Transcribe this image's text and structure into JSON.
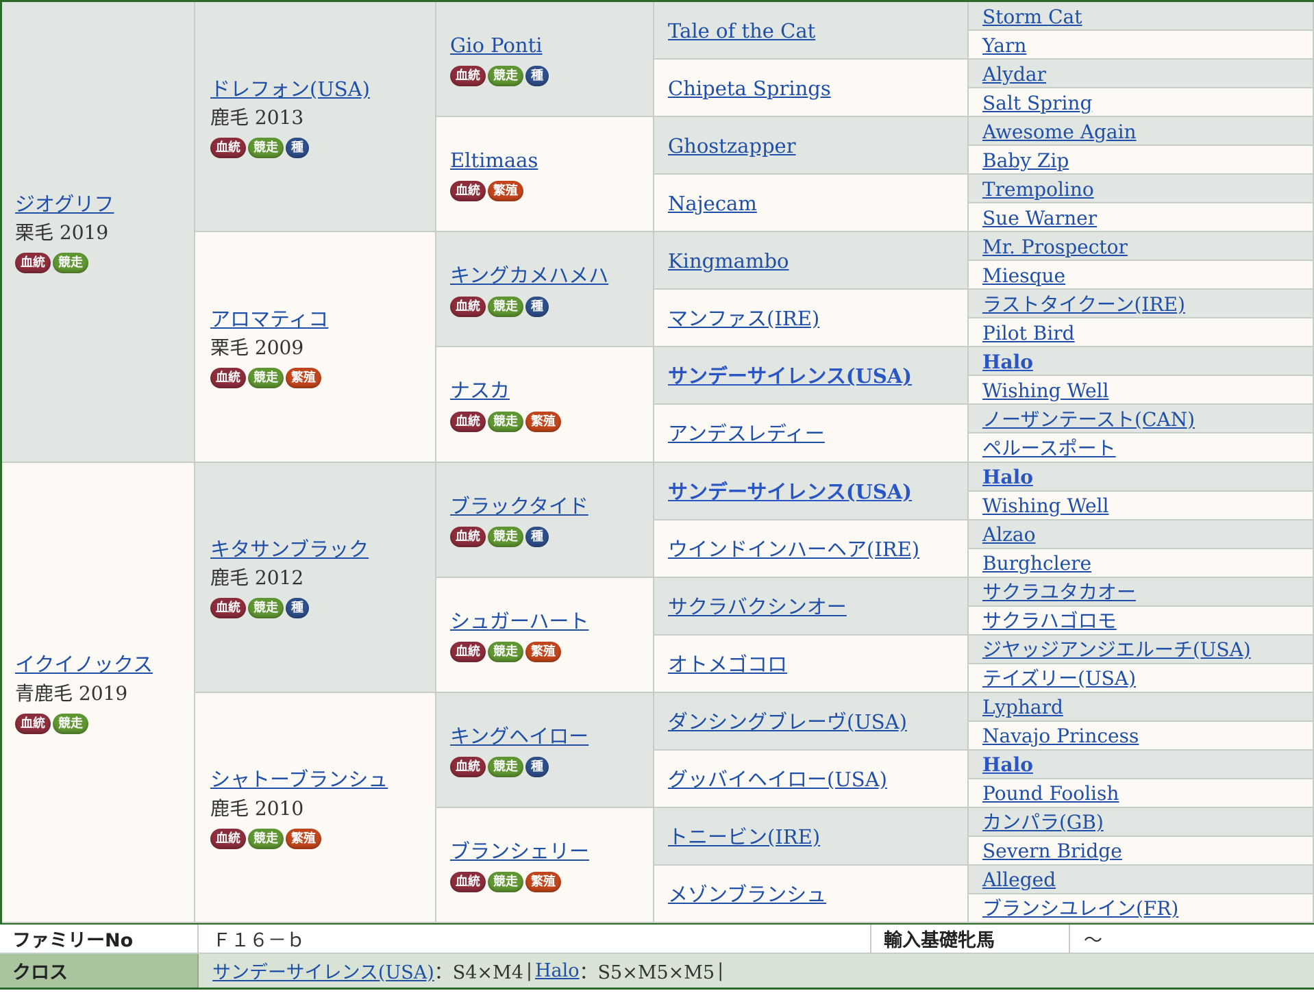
{
  "g1": [
    {
      "name": "ジオグリフ",
      "info": "栗毛 2019",
      "badges": [
        "blood",
        "race"
      ]
    },
    {
      "name": "イクイノックス",
      "info": "青鹿毛 2019",
      "badges": [
        "blood",
        "race"
      ]
    }
  ],
  "g2": [
    {
      "name": "ドレフォン(USA)",
      "info": "鹿毛 2013",
      "badges": [
        "blood",
        "race",
        "stud"
      ]
    },
    {
      "name": "アロマティコ",
      "info": "栗毛 2009",
      "badges": [
        "blood",
        "race",
        "breed"
      ]
    },
    {
      "name": "キタサンブラック",
      "info": "鹿毛 2012",
      "badges": [
        "blood",
        "race",
        "stud"
      ]
    },
    {
      "name": "シャトーブランシュ",
      "info": "鹿毛 2010",
      "badges": [
        "blood",
        "race",
        "breed"
      ]
    }
  ],
  "g3": [
    {
      "name": "Gio Ponti",
      "badges": [
        "blood",
        "race",
        "stud"
      ]
    },
    {
      "name": "Eltimaas",
      "badges": [
        "blood",
        "breed"
      ]
    },
    {
      "name": "キングカメハメハ",
      "badges": [
        "blood",
        "race",
        "stud"
      ]
    },
    {
      "name": "ナスカ",
      "badges": [
        "blood",
        "race",
        "breed"
      ]
    },
    {
      "name": "ブラックタイド",
      "badges": [
        "blood",
        "race",
        "stud"
      ]
    },
    {
      "name": "シュガーハート",
      "badges": [
        "blood",
        "race",
        "breed"
      ]
    },
    {
      "name": "キングヘイロー",
      "badges": [
        "blood",
        "race",
        "stud"
      ]
    },
    {
      "name": "ブランシェリー",
      "badges": [
        "blood",
        "race",
        "breed"
      ]
    }
  ],
  "g4": [
    {
      "name": "Tale of the Cat"
    },
    {
      "name": "Chipeta Springs"
    },
    {
      "name": "Ghostzapper"
    },
    {
      "name": "Najecam"
    },
    {
      "name": "Kingmambo"
    },
    {
      "name": "マンファス(IRE)"
    },
    {
      "name": "サンデーサイレンス(USA)",
      "bold": true
    },
    {
      "name": "アンデスレディー"
    },
    {
      "name": "サンデーサイレンス(USA)",
      "bold": true
    },
    {
      "name": "ウインドインハーヘア(IRE)"
    },
    {
      "name": "サクラバクシンオー"
    },
    {
      "name": "オトメゴコロ"
    },
    {
      "name": "ダンシングブレーヴ(USA)"
    },
    {
      "name": "グッバイヘイロー(USA)"
    },
    {
      "name": "トニービン(IRE)"
    },
    {
      "name": "メゾンブランシュ"
    }
  ],
  "g5": [
    {
      "name": "Storm Cat"
    },
    {
      "name": "Yarn"
    },
    {
      "name": "Alydar"
    },
    {
      "name": "Salt Spring"
    },
    {
      "name": "Awesome Again"
    },
    {
      "name": "Baby Zip"
    },
    {
      "name": "Trempolino"
    },
    {
      "name": "Sue Warner"
    },
    {
      "name": "Mr. Prospector"
    },
    {
      "name": "Miesque"
    },
    {
      "name": "ラストタイクーン(IRE)"
    },
    {
      "name": "Pilot Bird"
    },
    {
      "name": "Halo",
      "bold": true
    },
    {
      "name": "Wishing Well"
    },
    {
      "name": "ノーザンテースト(CAN)"
    },
    {
      "name": "ペルースポート"
    },
    {
      "name": "Halo",
      "bold": true
    },
    {
      "name": "Wishing Well"
    },
    {
      "name": "Alzao"
    },
    {
      "name": "Burghclere"
    },
    {
      "name": "サクラユタカオー"
    },
    {
      "name": "サクラハゴロモ"
    },
    {
      "name": "ジヤッジアンジエルーチ(USA)"
    },
    {
      "name": "テイズリー(USA)"
    },
    {
      "name": "Lyphard"
    },
    {
      "name": "Navajo Princess"
    },
    {
      "name": "Halo",
      "bold": true
    },
    {
      "name": "Pound Foolish"
    },
    {
      "name": "カンパラ(GB)"
    },
    {
      "name": "Severn Bridge"
    },
    {
      "name": "Alleged"
    },
    {
      "name": "ブランシユレイン(FR)"
    }
  ],
  "badge_labels": {
    "blood": "血統",
    "race": "競走",
    "stud": "種",
    "breed": "繁殖"
  },
  "colors": {
    "shade": "#e1e6e3",
    "plain": "#fdfaf6",
    "link": "#1f4fa8",
    "border": "#2d6b2d"
  },
  "footer": {
    "family_label": "ファミリーNo",
    "family_value": "Ｆ１６－ｂ",
    "import_label": "輸入基礎牝馬",
    "import_value": "～",
    "cross_label": "クロス",
    "cross": [
      {
        "name": "サンデーサイレンス(USA)",
        "value": "：S4×M4"
      },
      {
        "name": "Halo",
        "value": "：S5×M5×M5"
      }
    ]
  }
}
